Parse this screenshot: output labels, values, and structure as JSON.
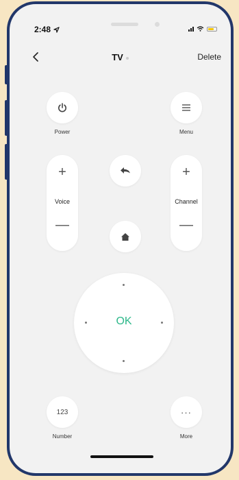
{
  "status_bar": {
    "time": "2:48",
    "battery_color": "#f4c400"
  },
  "nav": {
    "title": "TV",
    "delete_label": "Delete"
  },
  "buttons": {
    "power": "Power",
    "menu": "Menu",
    "voice": "Voice",
    "channel": "Channel",
    "ok": "OK",
    "number": "Number",
    "number_glyph": "123",
    "more": "More",
    "more_glyph": "···"
  },
  "colors": {
    "frame": "#22376a",
    "background": "#f7e6c3",
    "ok_accent": "#2db88a"
  }
}
